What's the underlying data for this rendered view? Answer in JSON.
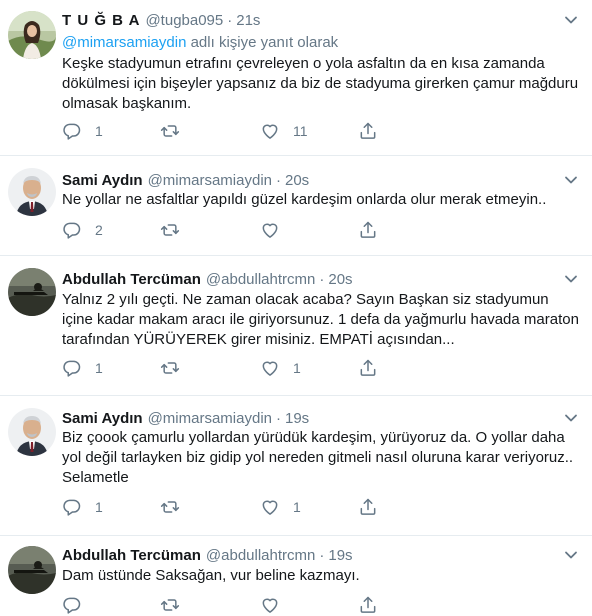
{
  "tweets": [
    {
      "name": "T U Ğ B A",
      "handle": "@tugba095",
      "sep": "·",
      "time": "21s",
      "reply_prefix": "",
      "reply_mention": "@mimarsamiaydin",
      "reply_suffix": " adlı kişiye yanıt olarak",
      "text": "Keşke stadyumun etrafını çevreleyen o yola asfaltın da en kısa zamanda dökülmesi için bişeyler yapsanız da biz de stadyuma girerken çamur mağduru olmasak başkanım.",
      "replies": "1",
      "retweets": "",
      "likes": "11"
    },
    {
      "name": "Sami Aydın",
      "handle": "@mimarsamiaydin",
      "sep": "·",
      "time": "20s",
      "text": "Ne yollar ne asfaltlar yapıldı güzel kardeşim onlarda olur merak etmeyin..",
      "replies": "2",
      "retweets": "",
      "likes": ""
    },
    {
      "name": "Abdullah Tercüman",
      "handle": "@abdullahtrcmn",
      "sep": "·",
      "time": "20s",
      "text": "Yalnız 2 yılı geçti. Ne zaman olacak acaba? Sayın Başkan siz stadyumun içine kadar makam aracı ile giriyorsunuz. 1 defa da yağmurlu havada maraton tarafından YÜRÜYEREK girer misiniz. EMPATİ açısından...",
      "replies": "1",
      "retweets": "",
      "likes": "1"
    },
    {
      "name": "Sami Aydın",
      "handle": "@mimarsamiaydin",
      "sep": "·",
      "time": "19s",
      "text": "Biz çoook çamurlu yollardan yürüdük kardeşim, yürüyoruz da. O yollar daha yol değil tarlayken biz gidip yol nereden gitmeli nasıl oluruna karar veriyoruz.. Selametle",
      "replies": "1",
      "retweets": "",
      "likes": "1"
    },
    {
      "name": "Abdullah Tercüman",
      "handle": "@abdullahtrcmn",
      "sep": "·",
      "time": "19s",
      "text": "Dam üstünde Saksağan, vur beline kazmayı.",
      "replies": "",
      "retweets": "",
      "likes": ""
    }
  ],
  "icons": {
    "reply": "reply-icon",
    "retweet": "retweet-icon",
    "like": "heart-icon",
    "share": "share-icon",
    "menu": "chevron-down-icon"
  },
  "colors": {
    "link": "#1da1f2",
    "muted": "#657786",
    "text": "#14171a",
    "border": "#e6ecf0"
  }
}
